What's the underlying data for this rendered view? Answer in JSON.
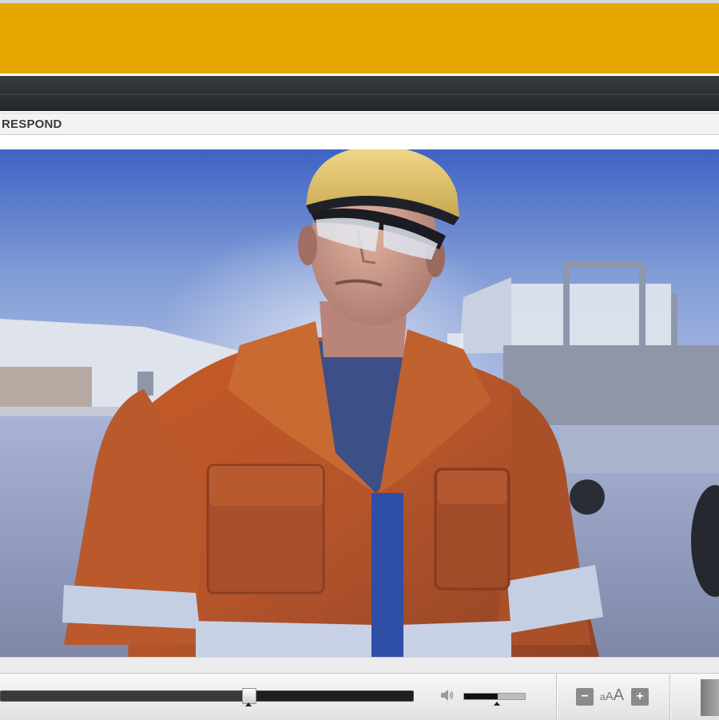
{
  "header": {
    "brand_color": "#e6a800",
    "nav_color": "#2f3235"
  },
  "page": {
    "title": "RESPOND"
  },
  "video": {
    "scene": "worker-in-hi-vis-jacket"
  },
  "player": {
    "progress_fraction": 0.6,
    "volume_fraction": 0.54,
    "volume_icon": "speaker-icon",
    "font_size_control": {
      "minus_label": "−",
      "plus_label": "+",
      "label_small": "a",
      "label_medium": "A",
      "label_large": "A"
    }
  }
}
